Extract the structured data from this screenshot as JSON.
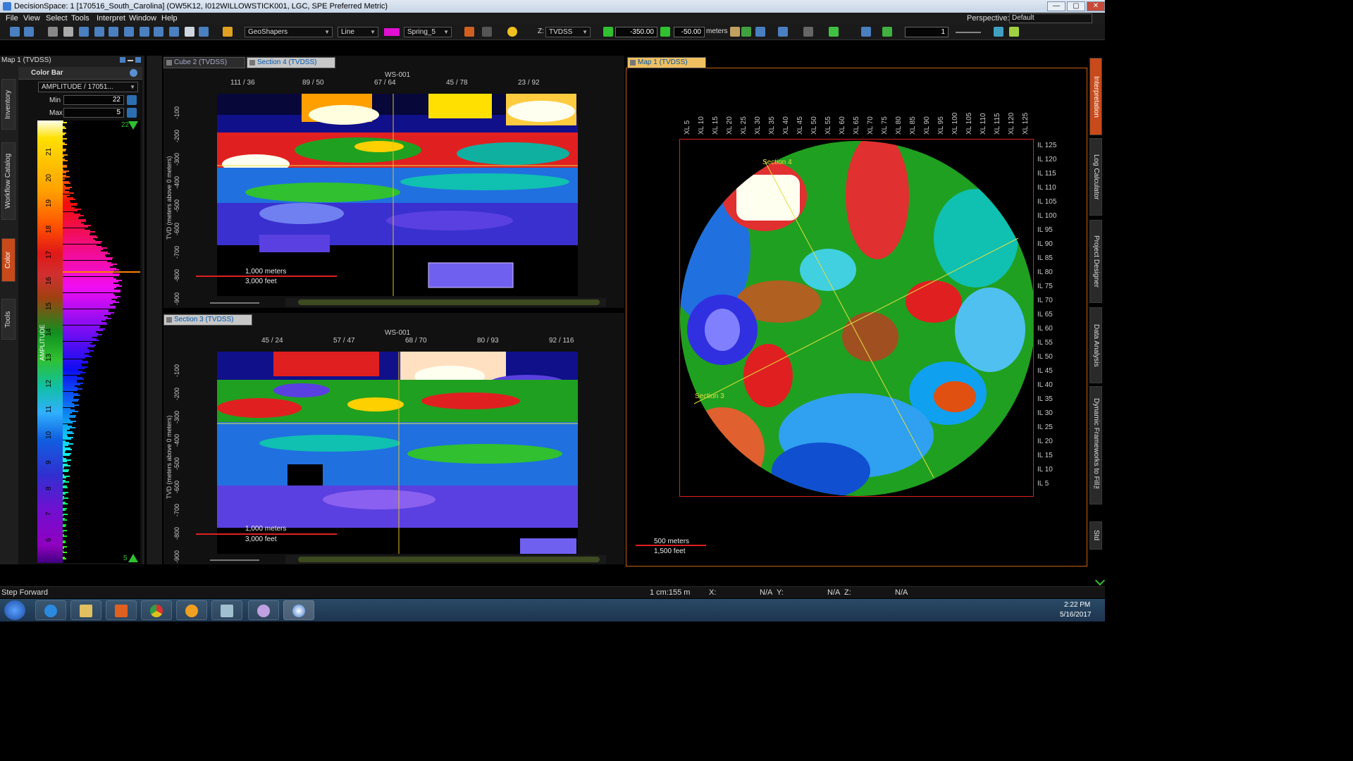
{
  "window": {
    "title": "DecisionSpace: 1 [170516_South_Carolina] (OW5K12, I012WILLOWSTICK001, LGC, SPE Preferred Metric)",
    "min_glyph": "—",
    "max_glyph": "▢",
    "close_glyph": "✕"
  },
  "menu": {
    "items": [
      "File",
      "View",
      "Select",
      "Tools",
      "Interpret",
      "Window",
      "Help"
    ],
    "perspective_label": "Perspective:",
    "perspective_value": "Default"
  },
  "toolbar": {
    "geoshapers": "GeoShapers",
    "line": "Line",
    "color_swatch": "#e010d0",
    "colormap": "Spring_5",
    "z_label": "Z:",
    "z_domain": "TVDSS",
    "z_from": "-350.00",
    "z_to": "-50.00",
    "units": "meters",
    "frame": "1"
  },
  "left_dock": {
    "title": "Map 1 (TVDSS)",
    "vertical_tabs": [
      "Inventory",
      "Workflow Catalog",
      "Color",
      "Tools"
    ],
    "color_bar": {
      "title": "Color Bar",
      "attribute": "AMPLITUDE / 17051...",
      "min_label": "Min",
      "min_value": "22",
      "max_label": "Max",
      "max_value": "5",
      "top_marker": "22",
      "bottom_marker": "5",
      "ticks": [
        "21",
        "20",
        "19",
        "18",
        "17",
        "16",
        "15",
        "14",
        "13",
        "12",
        "11",
        "10",
        "9",
        "8",
        "7",
        "6"
      ],
      "axis_label": "AMPLITUDE"
    }
  },
  "views": {
    "top_tabs": [
      "Cube 2 (TVDSS)",
      "Section 4 (TVDSS)"
    ],
    "section4": {
      "well": "WS-001",
      "x_ticks": [
        "111 / 36",
        "89 / 50",
        "67 / 64",
        "45 / 78",
        "23 / 92"
      ],
      "y_label": "TVD (meters above 0 meters)",
      "y_ticks": [
        "-100",
        "-200",
        "-300",
        "-400",
        "-500",
        "-600",
        "-700",
        "-800",
        "-900"
      ],
      "scale_m": "1,000 meters",
      "scale_ft": "3,000 feet"
    },
    "section3": {
      "tab": "Section 3 (TVDSS)",
      "well": "WS-001",
      "x_ticks": [
        "45 / 24",
        "57 / 47",
        "68 / 70",
        "80 / 93",
        "92 / 116"
      ],
      "y_label": "TVD (meters above 0 meters)",
      "y_ticks": [
        "-100",
        "-200",
        "-300",
        "-400",
        "-500",
        "-600",
        "-700",
        "-800",
        "-900"
      ],
      "scale_m": "1,000 meters",
      "scale_ft": "3,000 feet"
    },
    "map": {
      "tab": "Map 1 (TVDSS)",
      "xl_ticks": [
        "XL 5",
        "XL 10",
        "XL 15",
        "XL 20",
        "XL 25",
        "XL 30",
        "XL 35",
        "XL 40",
        "XL 45",
        "XL 50",
        "XL 55",
        "XL 60",
        "XL 65",
        "XL 70",
        "XL 75",
        "XL 80",
        "XL 85",
        "XL 90",
        "XL 95",
        "XL 100",
        "XL 105",
        "XL 110",
        "XL 115",
        "XL 120",
        "XL 125"
      ],
      "il_ticks": [
        "IL 125",
        "IL 120",
        "IL 115",
        "IL 110",
        "IL 105",
        "IL 100",
        "IL 95",
        "IL 90",
        "IL 85",
        "IL 80",
        "IL 75",
        "IL 70",
        "IL 65",
        "IL 60",
        "IL 55",
        "IL 50",
        "IL 45",
        "IL 40",
        "IL 35",
        "IL 30",
        "IL 25",
        "IL 20",
        "IL 15",
        "IL 10",
        "IL 5"
      ],
      "section4_label": "Section 4",
      "section3_label": "Section 3",
      "scale_m": "500 meters",
      "scale_ft": "1,500 feet"
    }
  },
  "right_tabs": [
    "Interpretation",
    "Log Calculator",
    "Project Designer",
    "Data Analysis",
    "Dynamic Frameworks to Fill™",
    "Std"
  ],
  "status": {
    "left": "Step Forward",
    "scale": "1 cm:155 m",
    "x_label": "X:",
    "x_value": "N/A",
    "y_label": "Y:",
    "y_value": "N/A",
    "z_label": "Z:",
    "z_value": "N/A"
  },
  "taskbar": {
    "time": "2:22 PM",
    "date": "5/16/2017"
  }
}
